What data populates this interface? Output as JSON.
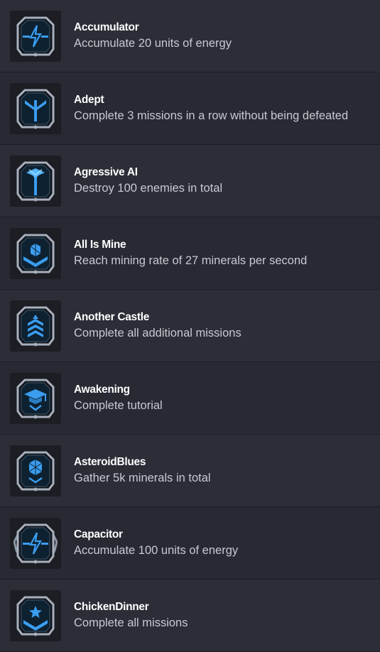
{
  "achievements": [
    {
      "title": "Accumulator",
      "description": "Accumulate 20 units of energy",
      "icon": "lightning-badge-icon"
    },
    {
      "title": "Adept",
      "description": "Complete 3 missions in a row without being defeated",
      "icon": "adept-trident-badge-icon"
    },
    {
      "title": "Agressive AI",
      "description": "Destroy 100 enemies in total",
      "icon": "wings-sword-badge-icon"
    },
    {
      "title": "All Is Mine",
      "description": "Reach mining rate of 27 minerals per second",
      "icon": "crystal-chevron-badge-icon"
    },
    {
      "title": "Another Castle",
      "description": "Complete all additional missions",
      "icon": "rank-chevrons-badge-icon"
    },
    {
      "title": "Awakening",
      "description": "Complete tutorial",
      "icon": "graduation-cap-badge-icon"
    },
    {
      "title": "AsteroidBlues",
      "description": "Gather 5k minerals in total",
      "icon": "crystal-badge-icon"
    },
    {
      "title": "Capacitor",
      "description": "Accumulate 100 units of energy",
      "icon": "lightning-wings-badge-icon"
    },
    {
      "title": "ChickenDinner",
      "description": "Complete all missions",
      "icon": "star-chevron-badge-icon"
    }
  ],
  "colors": {
    "badge_blue": "#3a9df0",
    "badge_frame": "#9aa3b3",
    "row_odd": "#2b2d37",
    "row_even": "#272933"
  }
}
